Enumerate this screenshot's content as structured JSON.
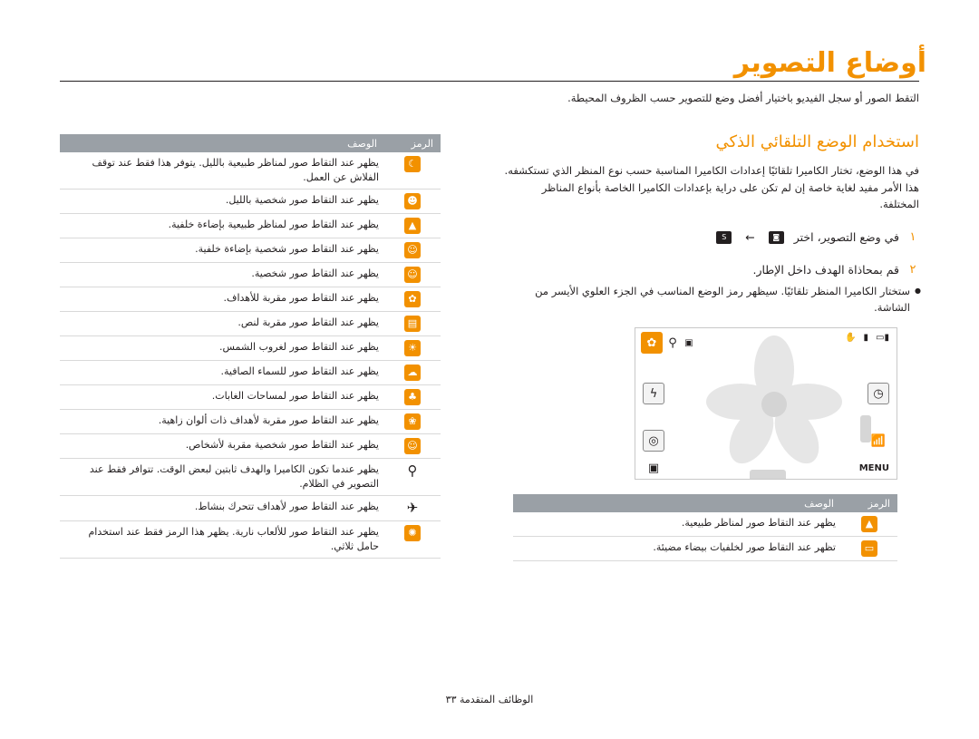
{
  "page": {
    "title": "أوضاع التصوير",
    "intro": "التقط الصور أو سجل الفيديو باختيار أفضل وضع للتصوير حسب الظروف المحيطة.",
    "footer": "الوظائف المتقدمة ٣٣"
  },
  "section": {
    "heading": "استخدام الوضع التلقائي الذكي",
    "text": "في هذا الوضع، تختار الكاميرا تلقائيًا إعدادات الكاميرا المناسبة حسب نوع المنظر الذي تستكشفه. هذا الأمر مفيد لغاية خاصة إن لم تكن على دراية بإعدادات الكاميرا الخاصة بأنواع المناظر المختلفة.",
    "step1_num": "١",
    "step1_text": "في وضع التصوير، اختر",
    "step1_icon_a": "camera-icon",
    "step1_arrow": "←",
    "step1_icon_b": "smart-auto-icon",
    "step2_num": "٢",
    "step2_text": "قم بمحاذاة الهدف داخل الإطار.",
    "bullet": "ستختار الكاميرا المنظر تلقائيًا. سيظهر رمز الوضع المناسب في الجزء العلوي الأيسر من الشاشة."
  },
  "camera_screen": {
    "menu_label": "MENU",
    "top_icons": [
      "battery-icon",
      "memory-icon",
      "stabilizer-icon"
    ],
    "mode_icons": [
      "macro-flower-icon",
      "tripod-icon",
      "smart-icon"
    ]
  },
  "table_main": {
    "col_icon": "الرمز",
    "col_desc": "الوصف",
    "rows": [
      {
        "icon": "night-landscape-icon",
        "glyph": "☾",
        "text": "يظهر عند التقاط صور لمناظر طبيعية بالليل. يتوفر هذا فقط عند توقف الفلاش عن العمل."
      },
      {
        "icon": "night-portrait-icon",
        "glyph": "☻",
        "text": "يظهر عند التقاط صور شخصية بالليل."
      },
      {
        "icon": "backlit-landscape-icon",
        "glyph": "▲",
        "text": "يظهر عند التقاط صور لمناظر طبيعية بإضاءة خلفية."
      },
      {
        "icon": "backlit-portrait-icon",
        "glyph": "☺",
        "text": "يظهر عند التقاط صور شخصية بإضاءة خلفية."
      },
      {
        "icon": "portrait-icon",
        "glyph": "☺",
        "text": "يظهر عند التقاط صور شخصية."
      },
      {
        "icon": "close-up-icon",
        "glyph": "✿",
        "text": "يظهر عند التقاط صور مقربة للأهداف."
      },
      {
        "icon": "text-close-up-icon",
        "glyph": "▤",
        "text": "يظهر عند التقاط صور مقربة لنص."
      },
      {
        "icon": "sunset-icon",
        "glyph": "☀",
        "text": "يظهر عند التقاط صور لغروب الشمس."
      },
      {
        "icon": "clear-sky-icon",
        "glyph": "☁",
        "text": "يظهر عند التقاط صور للسماء الصافية."
      },
      {
        "icon": "forest-icon",
        "glyph": "♣",
        "text": "يظهر عند التقاط صور لمساحات الغابات."
      },
      {
        "icon": "colorful-close-up-icon",
        "glyph": "❀",
        "text": "يظهر عند التقاط صور مقربة لأهداف ذات ألوان زاهية."
      },
      {
        "icon": "people-close-up-icon",
        "glyph": "☺",
        "text": "يظهر عند التقاط صور شخصية مقربة لأشخاص."
      },
      {
        "icon": "tripod-icon",
        "glyph": "⚲",
        "text": "يظهر عندما تكون الكاميرا والهدف ثابتين لبعض الوقت. تتوافر فقط عند التصوير في الظلام."
      },
      {
        "icon": "action-icon",
        "glyph": "✈",
        "text": "يظهر عند التقاط صور لأهداف تتحرك بنشاط."
      },
      {
        "icon": "fireworks-icon",
        "glyph": "✺",
        "text": "يظهر عند التقاط صور للألعاب نارية. يظهر هذا الرمز فقط عند استخدام حامل ثلاثي."
      }
    ]
  },
  "table_bottom": {
    "col_icon": "الرمز",
    "col_desc": "الوصف",
    "rows": [
      {
        "icon": "landscape-icon",
        "glyph": "▲",
        "text": "يظهر عند التقاط صور لمناظر طبيعية."
      },
      {
        "icon": "smart-white-icon",
        "glyph": "▭",
        "text": "تظهر عند التقاط صور لخلفيات بيضاء مضيئة."
      }
    ]
  },
  "colors": {
    "accent": "#f29100",
    "header_bg": "#9aa0a6",
    "text": "#231f20"
  }
}
